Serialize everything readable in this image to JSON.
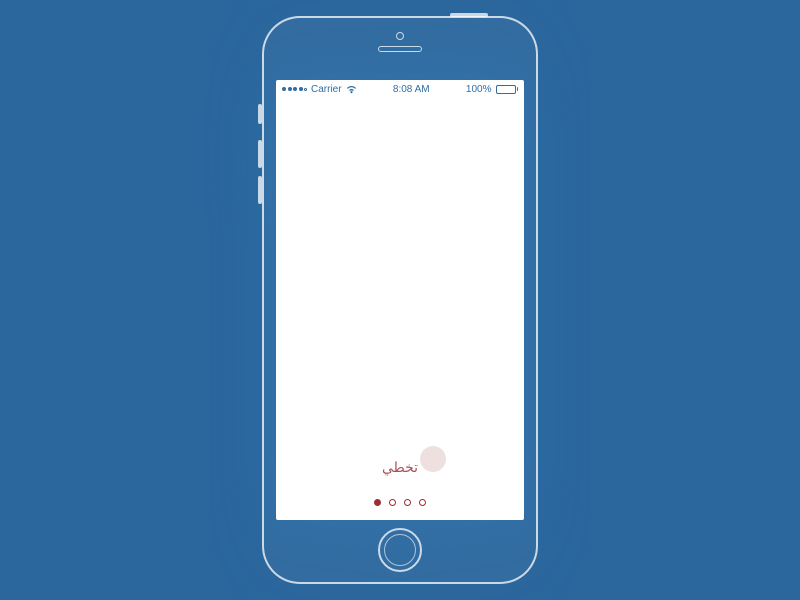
{
  "status": {
    "carrier": "Carrier",
    "time": "8:08 AM",
    "battery_pct": "100%"
  },
  "onboarding": {
    "skip_label": "تخطي",
    "page_count": 4,
    "active_page": 0
  }
}
